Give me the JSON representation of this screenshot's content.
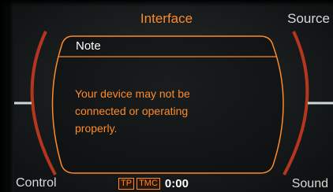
{
  "header": {
    "title": "Interface",
    "right_label": "Source"
  },
  "footer": {
    "left_label": "Control",
    "right_label": "Sound",
    "tp_badge": "TP",
    "tmc_badge": "TMC",
    "time": "0:00"
  },
  "dialog": {
    "title": "Note",
    "message_lines": [
      "Your device may not be",
      "connected or operating",
      "properly."
    ]
  },
  "colors": {
    "accent": "#ff8a2a",
    "frame_red": "#c63a20",
    "text_white": "#ffffff",
    "label_gray": "#d9d9d9"
  }
}
